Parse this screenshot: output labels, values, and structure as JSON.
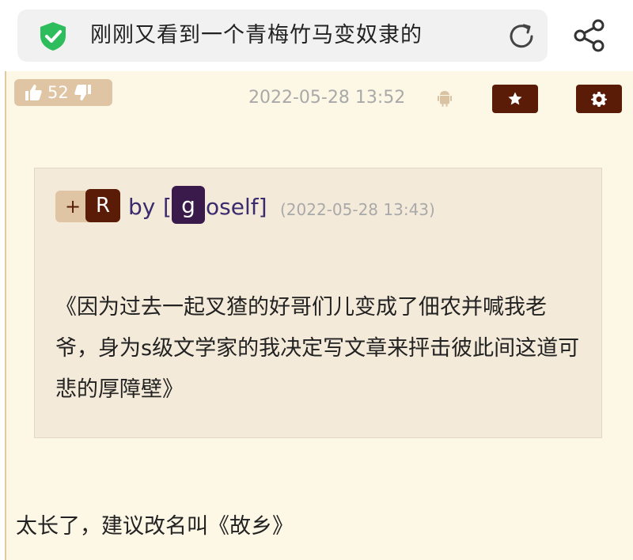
{
  "browser": {
    "page_title": "刚刚又看到一个青梅竹马变奴隶的"
  },
  "post": {
    "vote_count": "52",
    "timestamp": "2022-05-28 13:52",
    "quote": {
      "plus": "+",
      "avatar_letter": "R",
      "by": "by",
      "bracket_open": "[",
      "user_avatar_letter": "g",
      "user_name": "oself]",
      "time": "(2022-05-28 13:43)",
      "body": "《因为过去一起叉猹的好哥们儿变成了佃农并喊我老爷，身为s级文学家的我决定写文章来抨击彼此间这道可悲的厚障壁》"
    },
    "reply": "太长了，建议改名叫《故乡》"
  },
  "colors": {
    "accent_dark": "#5a1c06",
    "pill": "#dfc5a3",
    "card_bg": "#fdf7e5",
    "quote_bg": "#f4ead9",
    "shield_green": "#2ebd5c"
  },
  "icons": [
    "shield-check-icon",
    "reload-icon",
    "share-icon",
    "thumbs-up-icon",
    "thumbs-down-icon",
    "android-icon",
    "star-icon",
    "gear-icon"
  ]
}
